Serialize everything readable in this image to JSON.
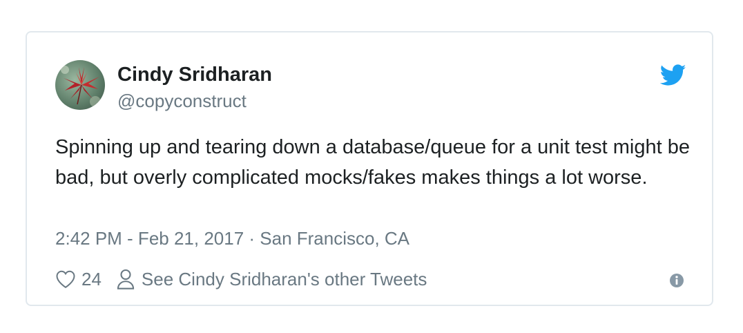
{
  "author": {
    "name": "Cindy Sridharan",
    "handle": "@copyconstruct",
    "avatar_icon": "maple-leaf-avatar"
  },
  "tweet": {
    "text": "Spinning up and tearing down a database/queue for a unit test might be bad, but overly complicated mocks/fakes makes things a lot worse.",
    "timestamp": "2:42 PM - Feb 21, 2017 · San Francisco, CA"
  },
  "actions": {
    "like_count": "24",
    "other_tweets_label": "See Cindy Sridharan's other Tweets"
  },
  "colors": {
    "twitter_blue": "#1da1f2",
    "text": "#1c2022",
    "muted": "#697882",
    "border": "#e1e8ed"
  },
  "icons": [
    "twitter-bird-icon",
    "heart-icon",
    "person-icon",
    "info-icon"
  ]
}
